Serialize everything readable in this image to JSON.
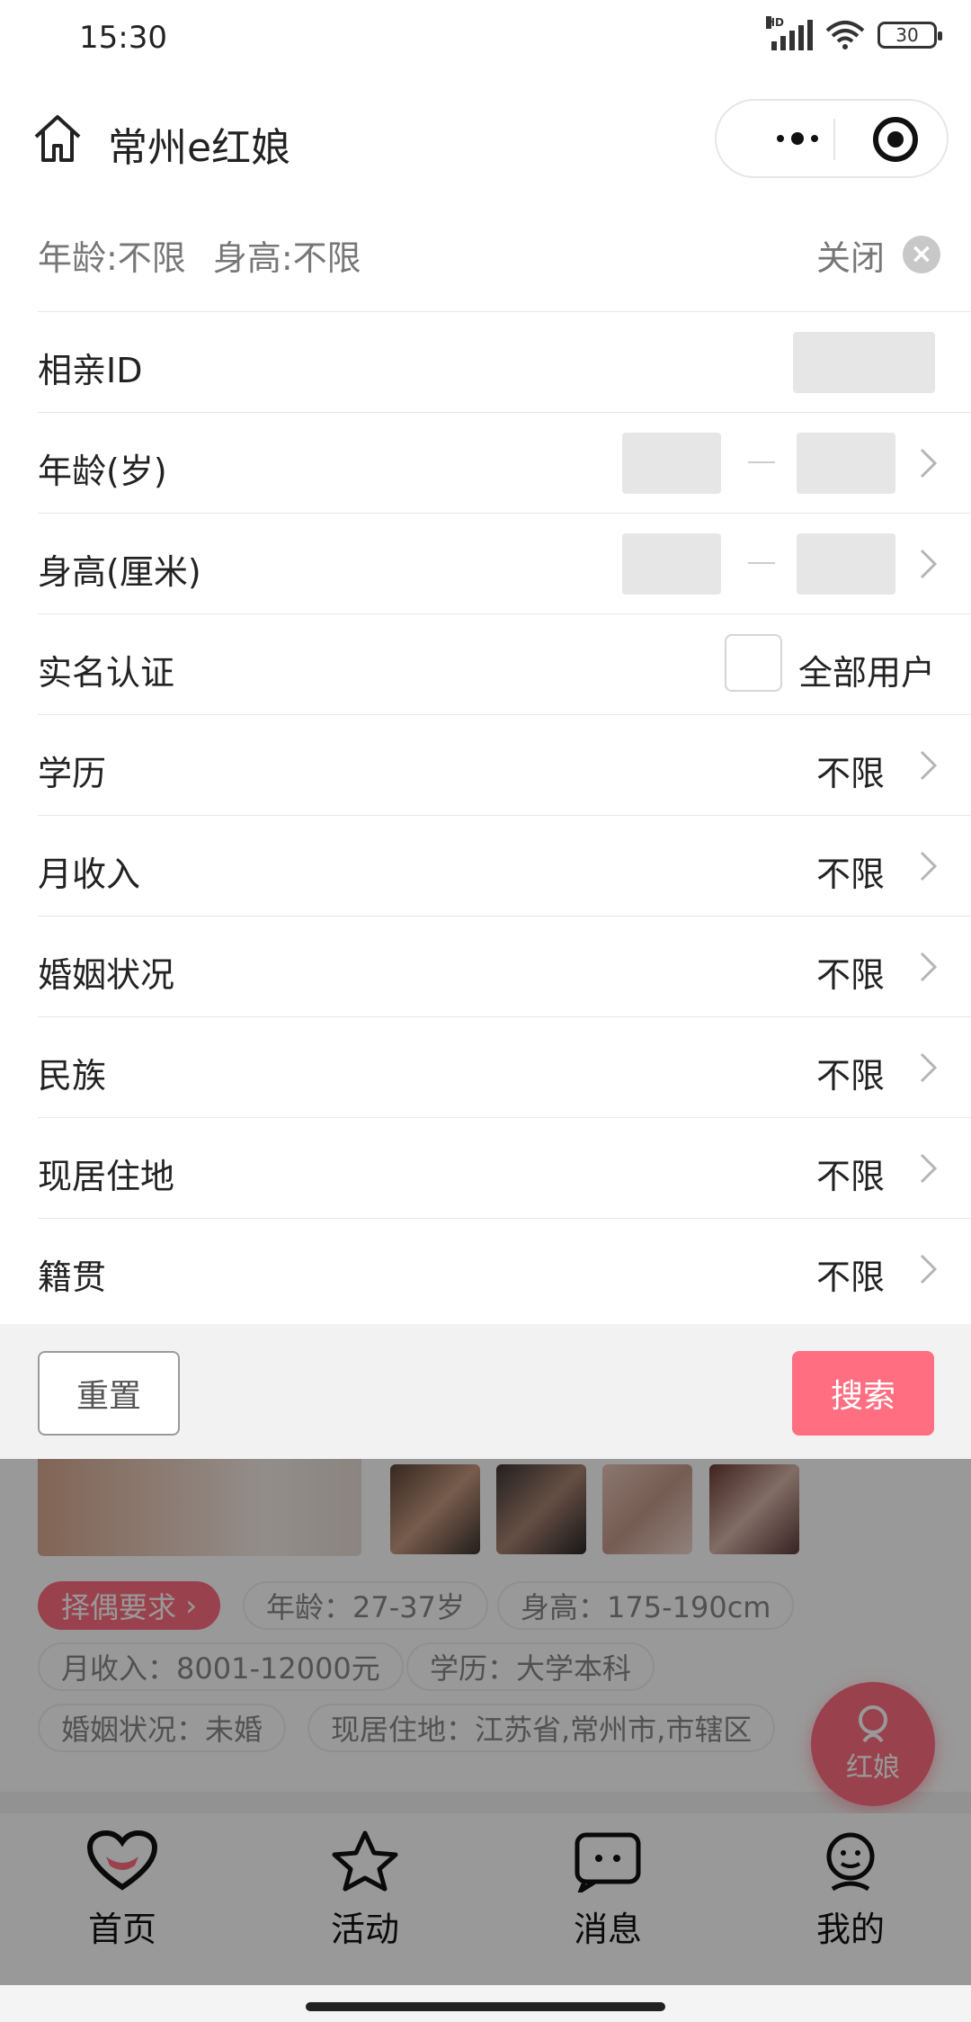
{
  "status_bar": {
    "time": "15:30",
    "signal": "HD",
    "battery": "30"
  },
  "title_bar": {
    "title": "常州e红娘"
  },
  "filter_summary": {
    "age": "年龄:不限",
    "height": "身高:不限",
    "close_label": "关闭"
  },
  "filters": [
    {
      "label": "相亲ID"
    },
    {
      "label": "年龄(岁)"
    },
    {
      "label": "身高(厘米)"
    },
    {
      "label": "实名认证",
      "option": "全部用户"
    },
    {
      "label": "学历",
      "value": "不限"
    },
    {
      "label": "月收入",
      "value": "不限"
    },
    {
      "label": "婚姻状况",
      "value": "不限"
    },
    {
      "label": "民族",
      "value": "不限"
    },
    {
      "label": "现居住地",
      "value": "不限"
    },
    {
      "label": "籍贯",
      "value": "不限"
    }
  ],
  "actions": {
    "reset": "重置",
    "search": "搜索"
  },
  "profile": {
    "requirement_tag": "择偶要求",
    "age": "年龄：27-37岁",
    "height": "身高：175-190cm",
    "income": "月收入：8001-12000元",
    "education": "学历：大学本科",
    "marital": "婚姻状况：未婚",
    "residence": "现居住地：江苏省,常州市,市辖区"
  },
  "float_button": {
    "label": "红娘"
  },
  "tabbar": [
    {
      "label": "首页",
      "icon": "heart-icon"
    },
    {
      "label": "活动",
      "icon": "star-icon"
    },
    {
      "label": "消息",
      "icon": "message-icon"
    },
    {
      "label": "我的",
      "icon": "person-icon"
    }
  ],
  "colors": {
    "accent": "#ff6f81",
    "overlay": "rgba(0,0,0,0.4)"
  }
}
